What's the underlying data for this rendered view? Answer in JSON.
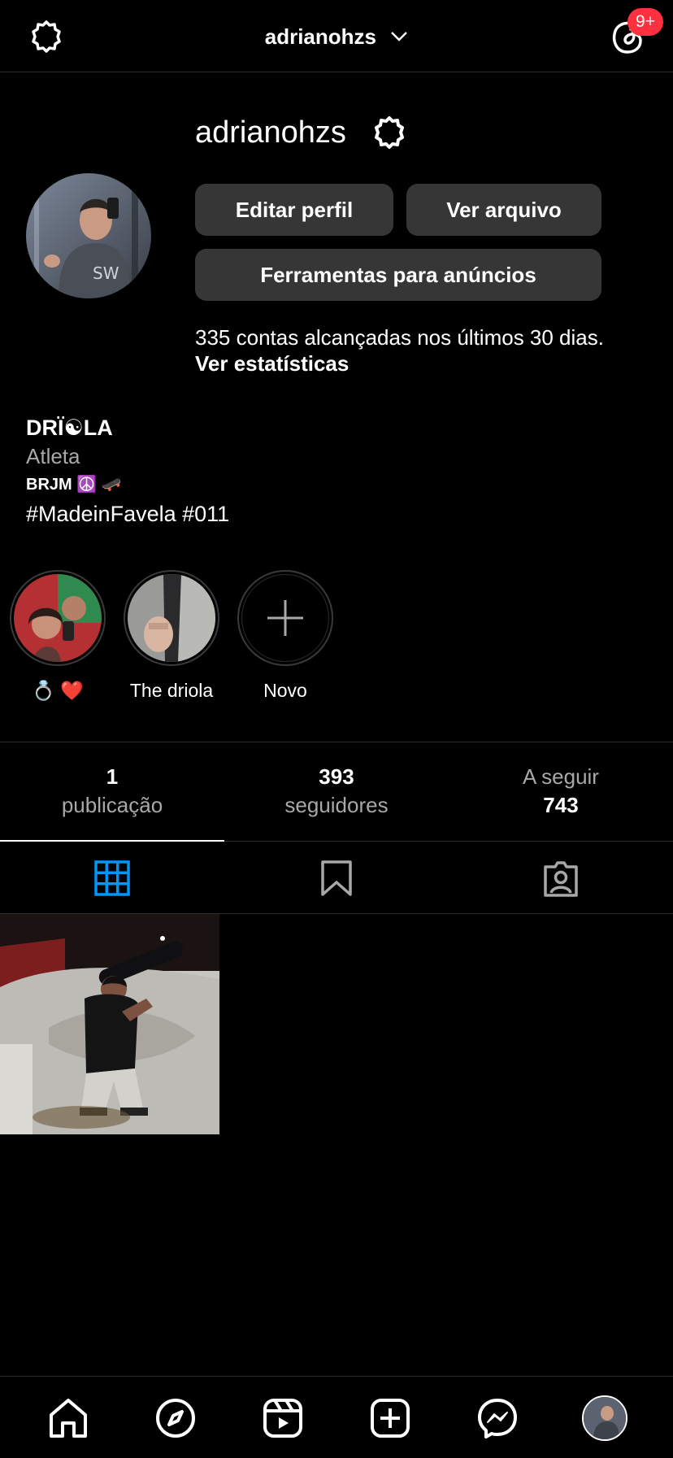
{
  "header": {
    "username": "adrianohzs",
    "notification_badge": "9+",
    "icons": [
      "settings-icon",
      "threads-icon"
    ]
  },
  "profile": {
    "username": "adrianohzs",
    "edit_profile": "Editar perfil",
    "view_archive": "Ver arquivo",
    "ad_tools": "Ferramentas para anúncios",
    "reach_text": "335 contas alcançadas nos últimos 30 dias.",
    "view_insights": "Ver estatísticas"
  },
  "bio": {
    "name": "DRÏ☯LA",
    "category": "Atleta",
    "line1": "BRJM ☮️ 🛹",
    "tags": "#MadeinFavela #011"
  },
  "highlights": [
    {
      "label": "💍 ❤️"
    },
    {
      "label": "The driola"
    },
    {
      "label": "Novo"
    }
  ],
  "counts": {
    "posts": {
      "value": "1",
      "label": "publicação"
    },
    "followers": {
      "value": "393",
      "label": "seguidores"
    },
    "following": {
      "value": "743",
      "label": "A seguir"
    }
  },
  "tabs": [
    "grid-icon",
    "saved-icon",
    "tagged-icon"
  ],
  "colors": {
    "accent_blue": "#0095f6",
    "badge_red": "#ff3040",
    "button_bg": "#363636"
  },
  "bottom_nav": [
    "home-icon",
    "explore-icon",
    "reels-icon",
    "create-icon",
    "messenger-icon",
    "profile-avatar"
  ]
}
